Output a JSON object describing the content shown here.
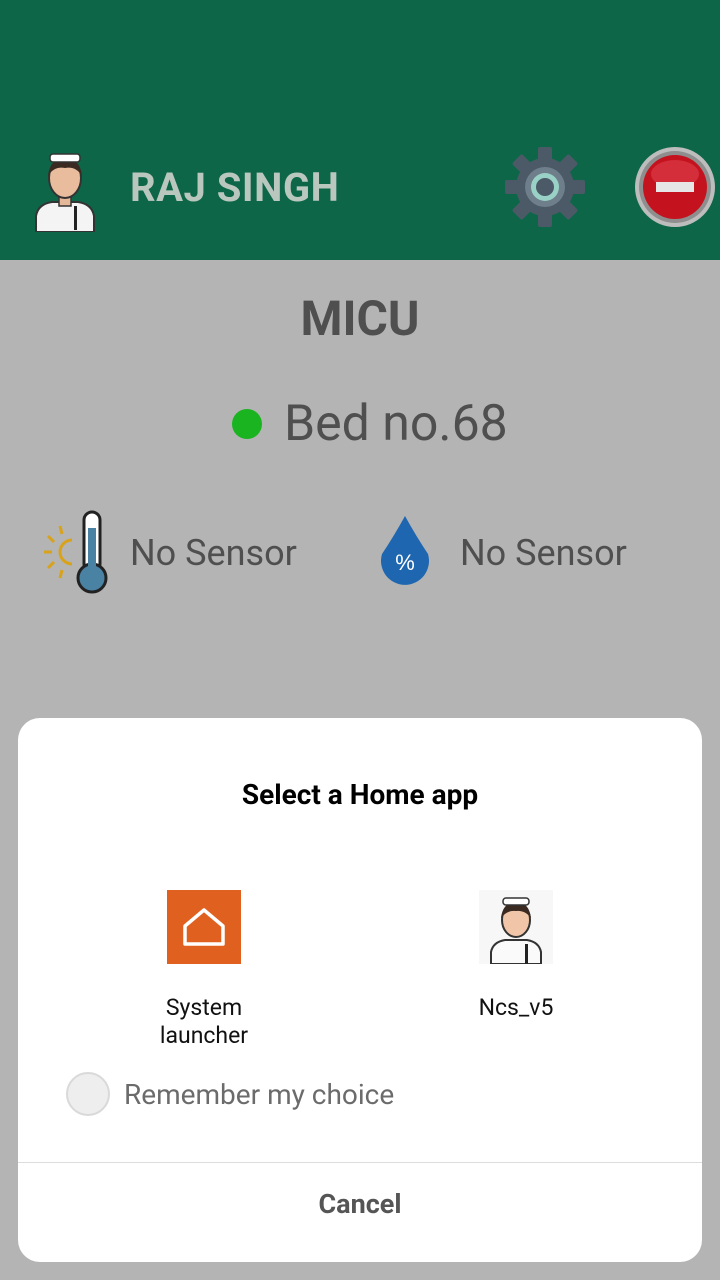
{
  "header": {
    "user_name": "RAJ SINGH",
    "bg_color": "#0e6649",
    "icons": [
      "nurse-avatar-icon",
      "gear-icon",
      "stop-icon"
    ]
  },
  "main": {
    "ward": "MICU",
    "bed_label": "Bed no.68",
    "bed_status_color": "#19b41f",
    "temperature_sensor_text": "No Sensor",
    "humidity_sensor_text": "No Sensor",
    "humidity_symbol": "%"
  },
  "dialog": {
    "title": "Select a Home app",
    "apps": [
      {
        "label_line1": "System",
        "label_line2": "launcher",
        "icon": "home-icon",
        "icon_color": "#e0601f"
      },
      {
        "label_line1": "Ncs_v5",
        "icon": "nurse-avatar-icon"
      }
    ],
    "remember_label": "Remember my choice",
    "cancel_label": "Cancel"
  }
}
